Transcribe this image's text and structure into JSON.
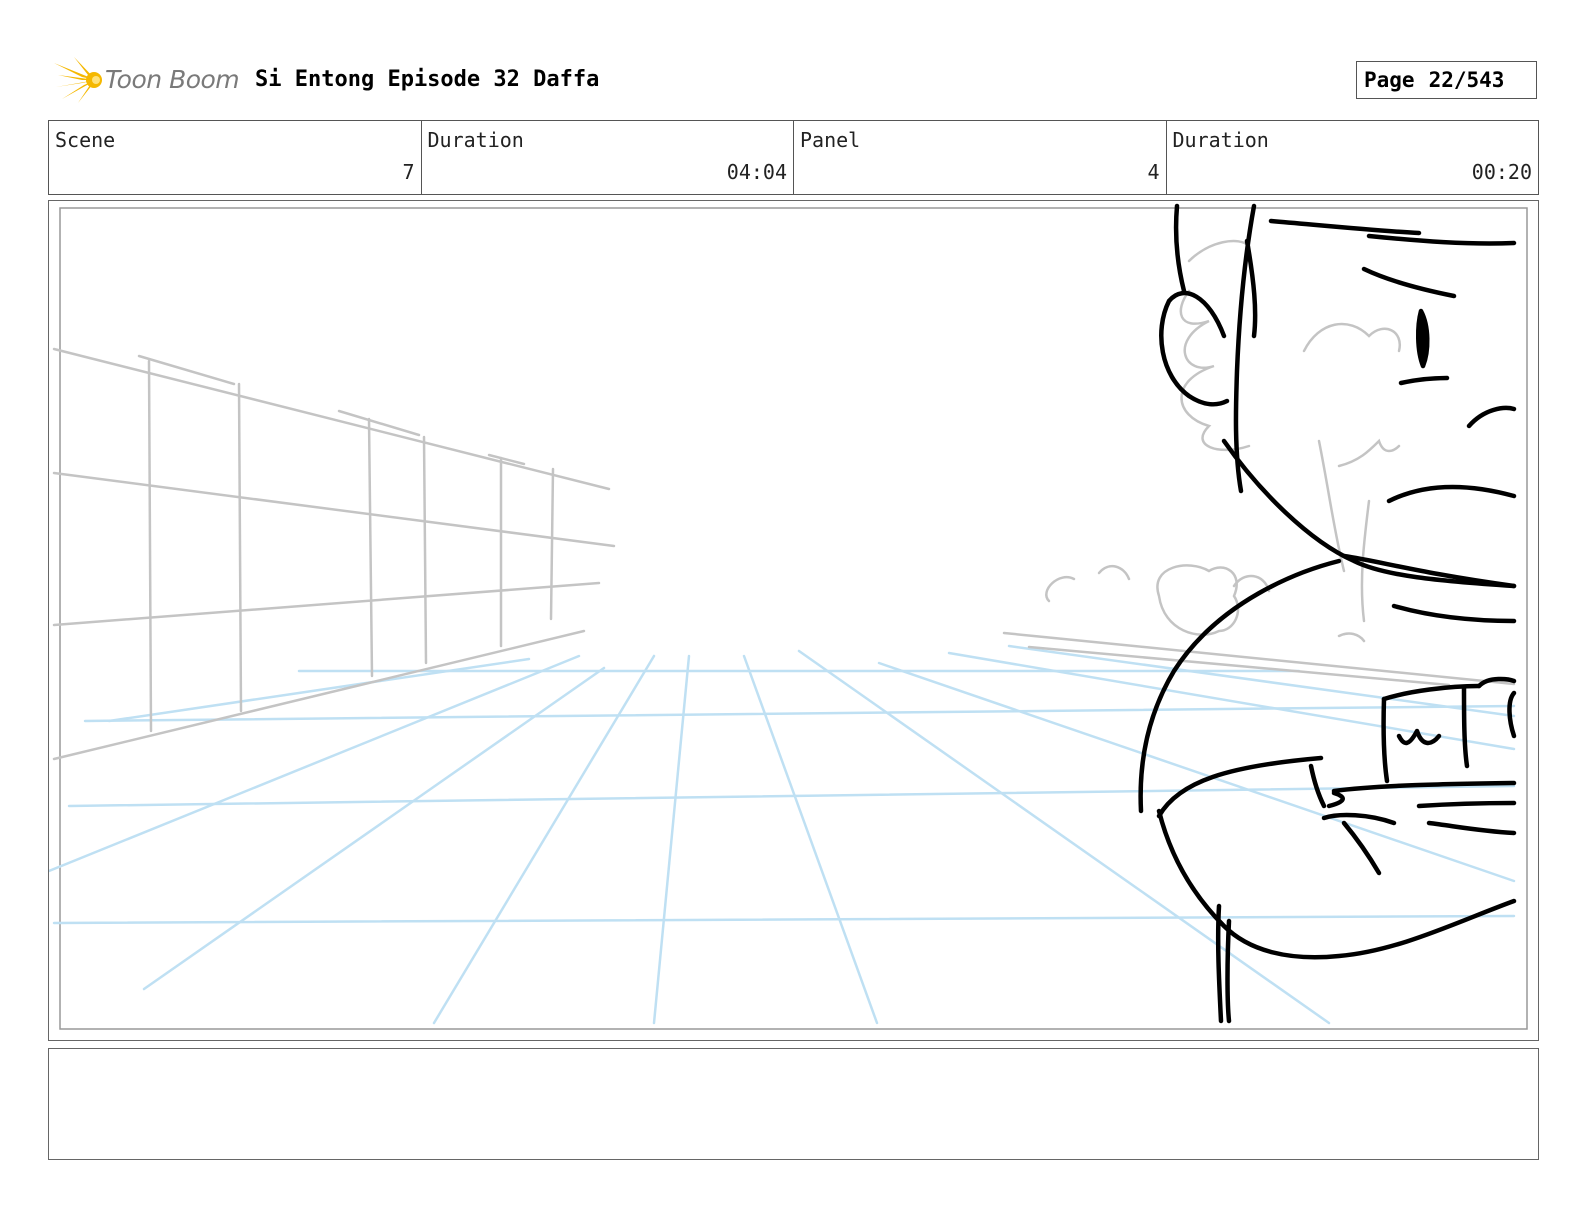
{
  "header": {
    "logo_text": "Toon Boom",
    "title": "Si Entong Episode 32 Daffa",
    "page_label": "Page",
    "page_value": "22/543"
  },
  "info": {
    "scene_label": "Scene",
    "scene_value": "7",
    "scene_duration_label": "Duration",
    "scene_duration_value": "04:04",
    "panel_label": "Panel",
    "panel_value": "4",
    "panel_duration_label": "Duration",
    "panel_duration_value": "00:20"
  },
  "colors": {
    "logo_yellow": "#f5b800",
    "perspective_grid": "#bfe0f3",
    "background_sketch": "#c4c4c4",
    "character_ink": "#000000"
  },
  "notes": {
    "text": ""
  }
}
